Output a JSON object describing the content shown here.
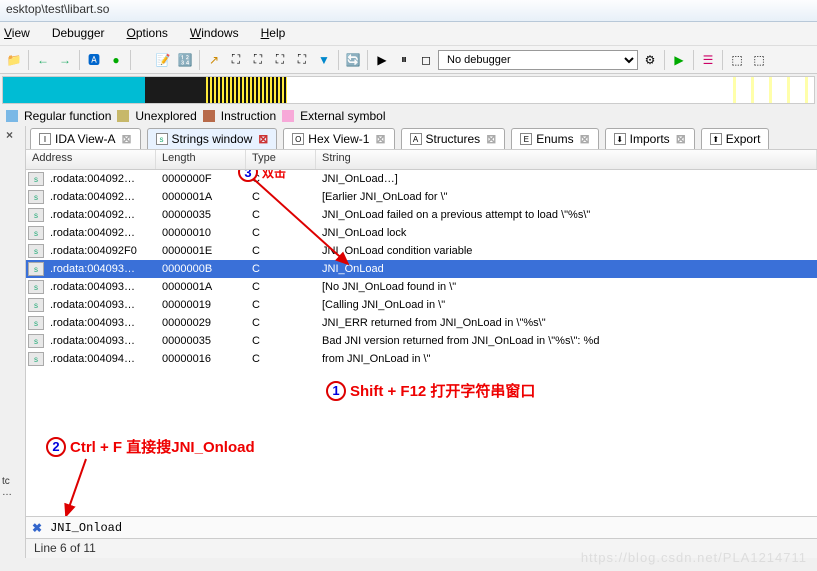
{
  "title": "esktop\\test\\libart.so",
  "menu": {
    "view": "View",
    "debugger": "Debugger",
    "options": "Options",
    "windows": "Windows",
    "help": "Help"
  },
  "debugger_select": "No debugger",
  "legend": {
    "regular": "Regular function",
    "unexplored": "Unexplored",
    "instruction": "Instruction",
    "external": "External symbol"
  },
  "tabs": {
    "ida": "IDA View-A",
    "strings": "Strings window",
    "hex": "Hex View-1",
    "structures": "Structures",
    "enums": "Enums",
    "imports": "Imports",
    "exports": "Export"
  },
  "columns": {
    "addr": "Address",
    "len": "Length",
    "type": "Type",
    "str": "String"
  },
  "rows": [
    {
      "addr": ".rodata:004092…",
      "len": "0000000F",
      "type": "C",
      "str": "JNI_OnLoad…]"
    },
    {
      "addr": ".rodata:004092…",
      "len": "0000001A",
      "type": "C",
      "str": "[Earlier JNI_OnLoad for \\\""
    },
    {
      "addr": ".rodata:004092…",
      "len": "00000035",
      "type": "C",
      "str": "JNI_OnLoad failed on a previous attempt to load \\\"%s\\\""
    },
    {
      "addr": ".rodata:004092…",
      "len": "00000010",
      "type": "C",
      "str": "JNI_OnLoad lock"
    },
    {
      "addr": ".rodata:004092F0",
      "len": "0000001E",
      "type": "C",
      "str": "JNI_OnLoad condition variable"
    },
    {
      "addr": ".rodata:004093…",
      "len": "0000000B",
      "type": "C",
      "str": "JNI_OnLoad"
    },
    {
      "addr": ".rodata:004093…",
      "len": "0000001A",
      "type": "C",
      "str": "[No JNI_OnLoad found in \\\""
    },
    {
      "addr": ".rodata:004093…",
      "len": "00000019",
      "type": "C",
      "str": "[Calling JNI_OnLoad in \\\""
    },
    {
      "addr": ".rodata:004093…",
      "len": "00000029",
      "type": "C",
      "str": "JNI_ERR returned from JNI_OnLoad in \\\"%s\\\""
    },
    {
      "addr": ".rodata:004093…",
      "len": "00000035",
      "type": "C",
      "str": "Bad JNI version returned from JNI_OnLoad in \\\"%s\\\": %d"
    },
    {
      "addr": ".rodata:004094…",
      "len": "00000016",
      "type": "C",
      "str": " from JNI_OnLoad in \\\""
    }
  ],
  "annotations": {
    "a1": "Shift + F12 打开字符串窗口",
    "a2": "Ctrl + F 直接搜JNI_Onload",
    "a3": "双击"
  },
  "search_value": "JNI_Onload",
  "status": "Line 6 of 11",
  "watermark": "https://blog.csdn.net/PLA1214711"
}
